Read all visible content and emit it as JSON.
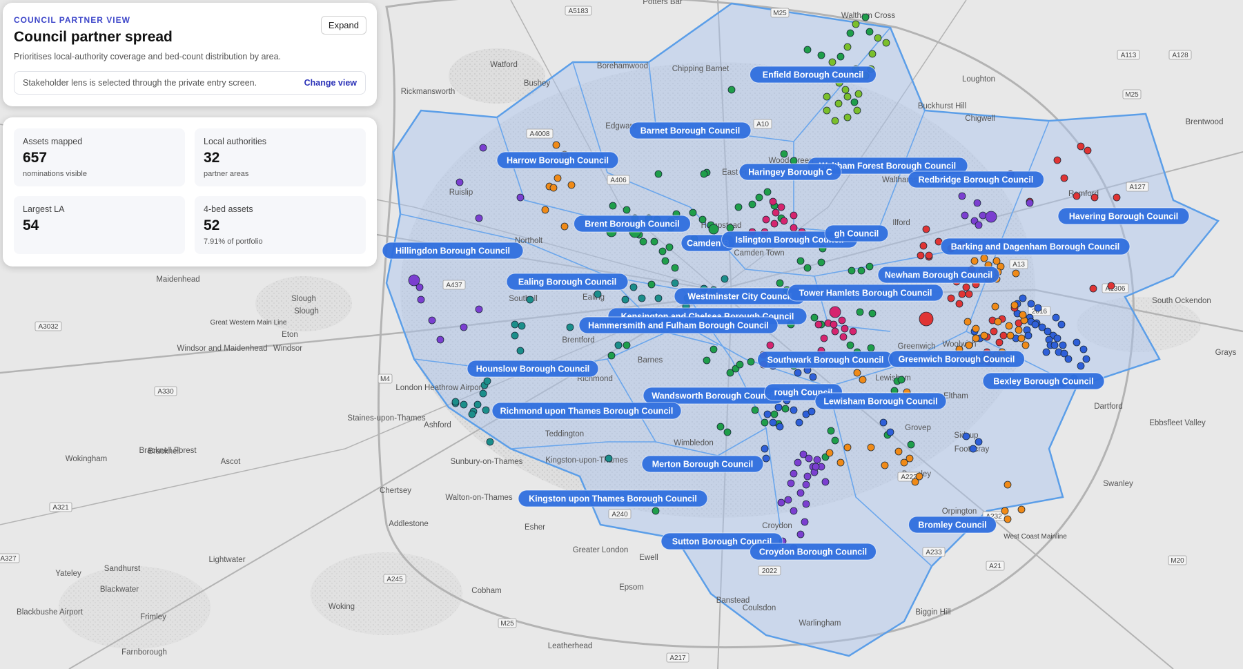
{
  "header": {
    "eyebrow": "COUNCIL PARTNER VIEW",
    "title": "Council partner spread",
    "subtitle": "Prioritises local-authority coverage and bed-count distribution by area.",
    "expand_label": "Expand",
    "lens_text": "Stakeholder lens is selected through the private entry screen.",
    "change_view_label": "Change view"
  },
  "stats": [
    {
      "label": "Assets mapped",
      "value": "657",
      "sub": "nominations visible"
    },
    {
      "label": "Local authorities",
      "value": "32",
      "sub": "partner areas"
    },
    {
      "label": "Largest LA",
      "value": "54",
      "sub": ""
    },
    {
      "label": "4-bed assets",
      "value": "52",
      "sub": "7.91% of portfolio"
    }
  ],
  "colors": {
    "accent": "#3d46c9",
    "boundary": "#5b9ee8",
    "boundary_fill": "#a9c3ef",
    "pill": "#2f6fde",
    "marker_green": "#1f9e4a",
    "marker_teal": "#1b8e8a",
    "marker_orange": "#f08a17",
    "marker_purple": "#7b3fd0",
    "marker_magenta": "#d6246e",
    "marker_red": "#e03434",
    "marker_blue": "#2e5fd8",
    "marker_lime": "#7bbf2b"
  },
  "councils": [
    "Enfield Borough Council",
    "Barnet Borough Council",
    "Harrow Borough Council",
    "Waltham Forest Borough Council",
    "Haringey Borough C",
    "Redbridge Borough Council",
    "Havering Borough Council",
    "Brent Borough Council",
    "Camden B",
    "Islington Borough Council",
    "gh Council",
    "Hillingdon Borough Council",
    "Barking and Dagenham Borough Council",
    "Ealing Borough Council",
    "Newham Borough Council",
    "Westminster City Council",
    "Tower Hamlets Borough Council",
    "Kensington and Chelsea Borough Council",
    "Hammersmith and Fulham Borough Council",
    "Hounslow Borough Council",
    "Southwark Borough Council",
    "Greenwich Borough Council",
    "Bexley Borough Council",
    "Wandsworth Borough Council",
    "rough Council",
    "Lewisham Borough Council",
    "Richmond upon Thames Borough Council",
    "Merton Borough Council",
    "Kingston upon Thames Borough Council",
    "Bromley Council",
    "Sutton Borough Council",
    "Croydon Borough Council"
  ],
  "places": [
    "Potters Bar",
    "Waltham Cross",
    "Watford",
    "Borehamwood",
    "Chipping Barnet",
    "Bushey",
    "Rickmansworth",
    "Loughton",
    "Buckhurst Hill",
    "Chigwell",
    "Brentwood",
    "Edgware",
    "Wood Green",
    "East Fi",
    "Walthamst",
    "Ruislip",
    "Romford",
    "Ilford",
    "Northolt",
    "Hampstead",
    "Camden Town",
    "Maidenhead",
    "Slough",
    "Southall",
    "Ealing",
    "South Ockendon",
    "Eton",
    "Windsor",
    "Brentford",
    "Barnes",
    "Greenwich",
    "Woolwich",
    "Grays",
    "Richmond",
    "Eltham",
    "Dartford",
    "Staines-upon-Thames",
    "Ashford",
    "Ebbsfleet Valley",
    "Bracknell",
    "Teddington",
    "Wimbledon",
    "Wokingham",
    "Ascot",
    "Sunbury-on-Thames",
    "Kingston-upon-Thames",
    "Swanley",
    "Chertsey",
    "Walton-on-Thames",
    "Addlestone",
    "Esher",
    "Orpington",
    "Yateley",
    "Sandhurst",
    "Lightwater",
    "Blackwater",
    "Ewell",
    "Cobham",
    "Epsom",
    "Banstead",
    "Coulsdon",
    "Biggin Hill",
    "Frimley",
    "Woking",
    "Warlingham",
    "Farnborough",
    "Leatherhead",
    "Croydon",
    "Grovep",
    "Bromley",
    "Footscray",
    "Sidcup",
    "Lewisham",
    "London Heathrow Airport",
    "Windsor and Maidenhead",
    "Bracknell Forest",
    "Blackbushe Airport",
    "Greater London",
    "Slough"
  ],
  "roads": [
    "A5183",
    "M25",
    "A113",
    "A128",
    "M25",
    "A4008",
    "A10",
    "A406",
    "A127",
    "A437",
    "A13",
    "A1306",
    "M4",
    "A3032",
    "A330",
    "A321",
    "M25",
    "A240",
    "A232",
    "A222",
    "A233",
    "A21",
    "M20",
    "A245",
    "A217",
    "A327",
    "2016",
    "2022",
    "West Coast Mainline",
    "Great Western Main Line"
  ]
}
